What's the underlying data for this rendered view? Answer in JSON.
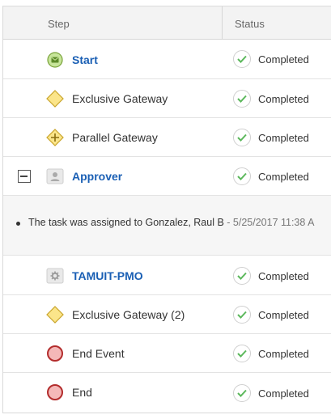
{
  "header": {
    "step": "Step",
    "status": "Status"
  },
  "rows": [
    {
      "label": "Start",
      "icon": "message-start-icon",
      "status": "Completed",
      "link": true
    },
    {
      "label": "Exclusive Gateway",
      "icon": "exclusive-gateway-icon",
      "status": "Completed",
      "link": false
    },
    {
      "label": "Parallel Gateway",
      "icon": "parallel-gateway-icon",
      "status": "Completed",
      "link": false
    },
    {
      "label": "Approver",
      "icon": "user-task-icon",
      "status": "Completed",
      "link": true,
      "expanded": true
    },
    {
      "label": "TAMUIT-PMO",
      "icon": "service-task-icon",
      "status": "Completed",
      "link": true
    },
    {
      "label": "Exclusive Gateway (2)",
      "icon": "exclusive-gateway-icon",
      "status": "Completed",
      "link": false
    },
    {
      "label": "End Event",
      "icon": "end-event-icon",
      "status": "Completed",
      "link": false
    },
    {
      "label": "End",
      "icon": "end-event-icon",
      "status": "Completed",
      "link": false
    }
  ],
  "detail": {
    "text": "The task was assigned to Gonzalez, Raul B",
    "separator": " - ",
    "date": "5/25/2017 11:38 A"
  },
  "colors": {
    "link": "#1a5fb4",
    "check": "#5cb85c",
    "gateway": "#fbe58a",
    "end_event": "#f4b8b8"
  }
}
